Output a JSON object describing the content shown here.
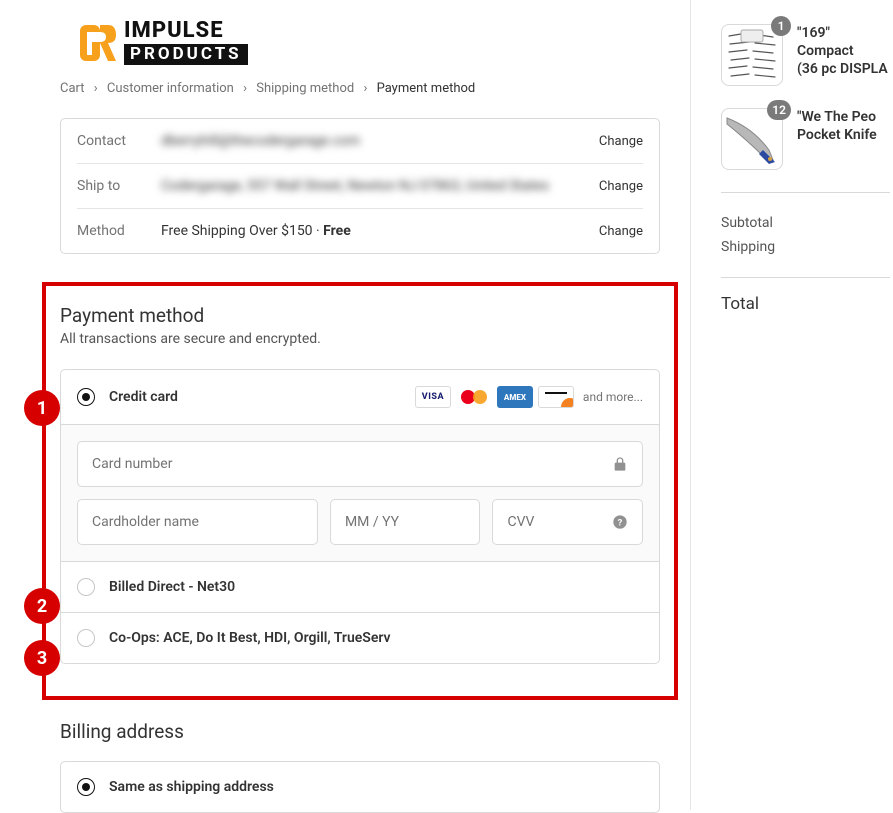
{
  "logo": {
    "line1": "IMPULSE",
    "line2": "PRODUCTS"
  },
  "breadcrumb": {
    "cart": "Cart",
    "customer": "Customer information",
    "shipping": "Shipping method",
    "payment": "Payment method"
  },
  "review": {
    "contact_label": "Contact",
    "contact_value": "dberryhill@thecodergarage.com",
    "shipto_label": "Ship to",
    "shipto_value": "Codergarage, 557 Wall Street, Newton NJ 07863, United States",
    "method_label": "Method",
    "method_value": "Free Shipping Over $150 · ",
    "method_bold": "Free",
    "change": "Change"
  },
  "payment": {
    "title": "Payment method",
    "subtitle": "All transactions are secure and encrypted.",
    "credit_card": "Credit card",
    "and_more": "and more...",
    "card_number": "Card number",
    "cardholder": "Cardholder name",
    "expiry": "MM / YY",
    "cvv": "CVV",
    "billed_direct": "Billed Direct - Net30",
    "coops": "Co-Ops: ACE, Do It Best, HDI, Orgill, TrueServ"
  },
  "annotations": {
    "one": "1",
    "two": "2",
    "three": "3"
  },
  "billing": {
    "title": "Billing address",
    "same": "Same as shipping address"
  },
  "cart": {
    "items": [
      {
        "qty": "1",
        "name": "\"169\" Compact\n(36 pc DISPLA"
      },
      {
        "qty": "12",
        "name": "\"We The Peo\nPocket Knife"
      }
    ],
    "subtotal_label": "Subtotal",
    "shipping_label": "Shipping",
    "total_label": "Total"
  },
  "card_brands": {
    "visa": "VISA",
    "amex": "AMEX"
  }
}
